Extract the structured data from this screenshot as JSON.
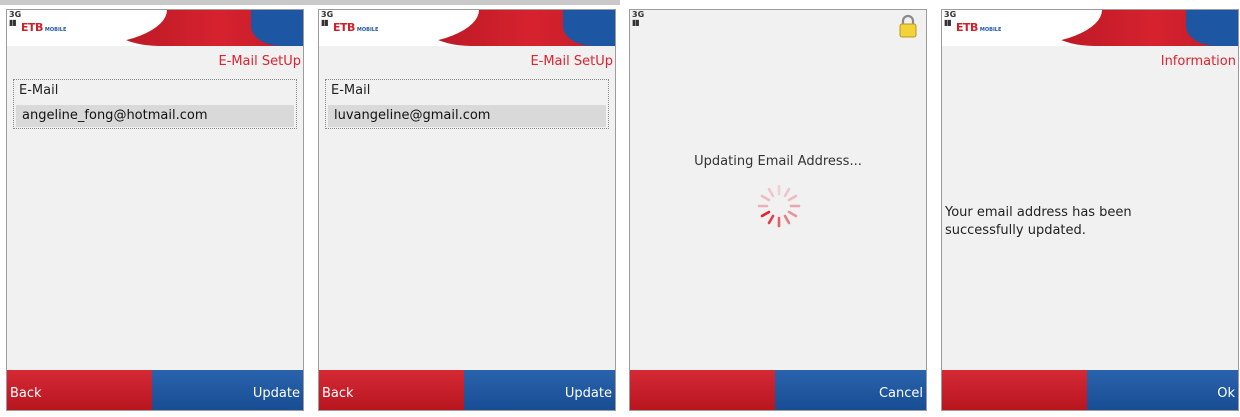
{
  "screens": [
    {
      "brand": {
        "network": "3G",
        "logo_main": "ETB",
        "logo_sub": "MOBILE"
      },
      "title": "E-Mail SetUp",
      "field_label": "E-Mail",
      "field_value": "angeline_fong@hotmail.com",
      "softkey_left": "Back",
      "softkey_right": "Update"
    },
    {
      "brand": {
        "network": "3G",
        "logo_main": "ETB",
        "logo_sub": "MOBILE"
      },
      "title": "E-Mail SetUp",
      "field_label": "E-Mail",
      "field_value": "luvangeline@gmail.com",
      "softkey_left": "Back",
      "softkey_right": "Update"
    },
    {
      "brand": {
        "network": "3G"
      },
      "status_icon": "lock-icon",
      "message": "Updating Email Address...",
      "softkey_left": "",
      "softkey_right": "Cancel"
    },
    {
      "brand": {
        "network": "3G",
        "logo_main": "ETB",
        "logo_sub": "MOBILE"
      },
      "title": "Information",
      "message_line1": "Your email address has been",
      "message_line2": "successfully updated.",
      "softkey_left": "",
      "softkey_right": "Ok"
    }
  ],
  "colors": {
    "accent_red": "#d6222f",
    "accent_blue": "#1d56a3",
    "background": "#f1f1f1"
  }
}
